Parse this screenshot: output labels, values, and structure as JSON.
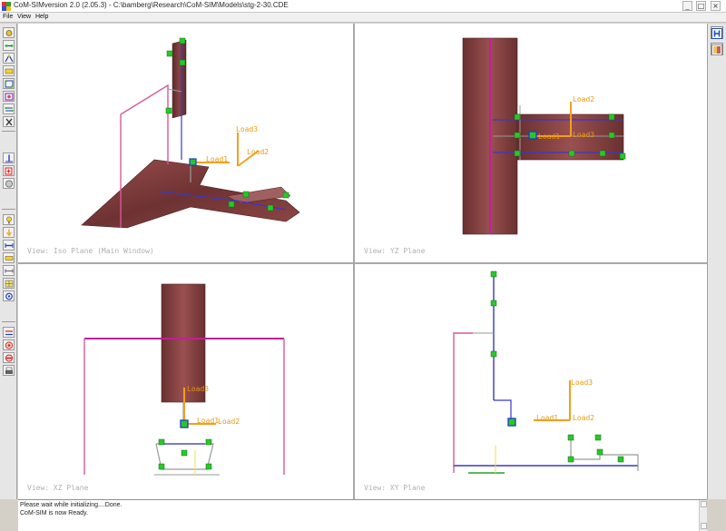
{
  "window": {
    "title": "CoM-SIMversion 2.0 (2.05.3) - C:\\bamberg\\Research\\CoM-SIM\\Models\\stg-2-30.CDE",
    "minimize_glyph": "_",
    "maximize_glyph": "□",
    "close_glyph": "×"
  },
  "menu": {
    "items": [
      {
        "label": "File"
      },
      {
        "label": "View"
      },
      {
        "label": "Help"
      }
    ]
  },
  "viewports": {
    "iso": {
      "label": "View: Iso Plane (Main Window)",
      "loads": [
        "Load1",
        "Load2",
        "Load3"
      ]
    },
    "yz": {
      "label": "View: YZ Plane",
      "loads": [
        "Load1",
        "Load2",
        "Load3"
      ]
    },
    "xz": {
      "label": "View: XZ Plane",
      "loads": [
        "Load1",
        "Load2",
        "Load3"
      ]
    },
    "xy": {
      "label": "View: XY Plane",
      "loads": [
        "Load1",
        "Load2",
        "Load3"
      ]
    }
  },
  "status": {
    "lines": [
      "Please wait while initializing....Done.",
      "CoM-SIM is now Ready."
    ]
  },
  "colors": {
    "platform": "#7a3b3b",
    "platform_dark": "#5a2a2a",
    "load_arrow": "#f0a020",
    "beam_blue": "#3838c8",
    "beam_pink": "#d65a9a",
    "beam_magenta": "#c0209a",
    "node_green": "#28c828",
    "cursor_box": "#1a3ac8",
    "viewport_bg": "#ffffff",
    "label_gray": "#b0b0b0"
  },
  "icons": {
    "left_toolbar": [
      "select-icon",
      "joint-icon",
      "member-icon",
      "support-icon",
      "node-icon",
      "connect-icon",
      "link-icon",
      "tools-icon",
      "vertical-member-icon",
      "add-node-icon",
      "sphere-icon",
      "light-icon",
      "load-icon",
      "measure-icon",
      "beam-icon",
      "dimension-icon",
      "grid-icon",
      "rotate-icon",
      "align-icon",
      "target-icon",
      "disable-icon",
      "print-icon"
    ],
    "right_toolbar": [
      "h-view-icon",
      "panel-toggle-icon"
    ]
  }
}
